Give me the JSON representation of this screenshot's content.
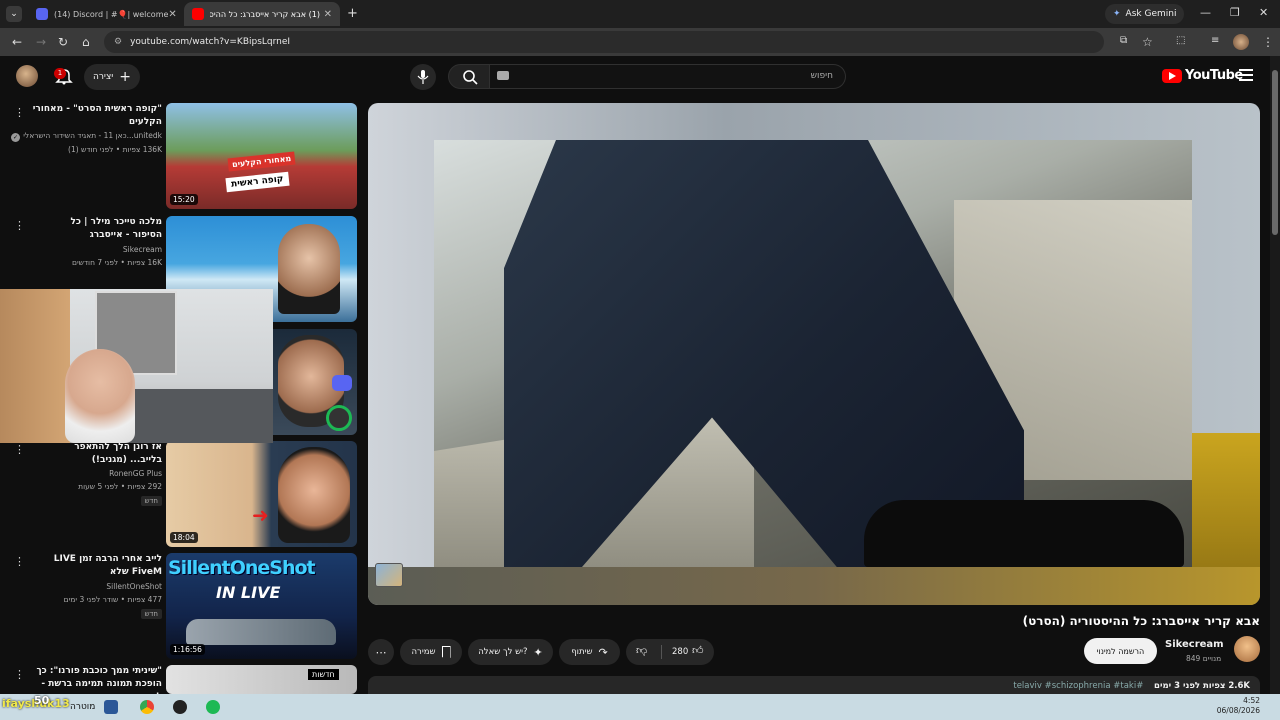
{
  "browser": {
    "tabs": [
      {
        "label": "(14) Discord | #🎈| welcome"
      },
      {
        "label": "(1) אבא קריר אייסברג: כל ההיסטוריה"
      }
    ],
    "gemini_label": "Ask Gemini",
    "url": "youtube.com/watch?v=KBipsLqrneI"
  },
  "yt": {
    "logo": "YouTube",
    "search_placeholder": "חיפוש",
    "create_label": "יצירה",
    "notif_count": "1"
  },
  "video": {
    "title": "אבא קריר אייסברג: כל ההיסטוריה (הסרט)",
    "channel": "Sikecream",
    "subscribers": "849 מנויים",
    "subscribe_label": "הרשמה למינוי",
    "likes": "280",
    "share_label": "שיתוף",
    "ask_label": "יש לך שאלה?",
    "save_label": "שמירה",
    "views_line": "2.6K צפיות  לפני 3 ימים",
    "tags": "#telaviv #schizophrenia #taki"
  },
  "recommendations": [
    {
      "title": "\"קופה ראשית הסרט\" - מאחורי הקלעים",
      "channel": "unitedk...כאן 11 - תאגיד השידור הישראלי",
      "meta": "136K צפיות • לפני חודש (1)",
      "duration": "15:20",
      "badge": ""
    },
    {
      "title": "מלכה טייכר מילר | כל הסיפור - אייסברג",
      "channel": "Sikecream",
      "meta": "16K צפיות • לפני 7 חודשים",
      "duration": "",
      "badge": ""
    },
    {
      "title": "אז רונן הלך להתאפר בלייב... (מגניב!)",
      "channel": "RonenGG Plus",
      "meta": "292 צפיות • לפני 5 שעות",
      "duration": "18:04",
      "badge": "חדש"
    },
    {
      "title": "לייב אחרי הרבה זמן LIVE FiveM שלא",
      "channel": "SillentOneShot",
      "meta": "477 צפיות • שודר לפני 3 ימים",
      "duration": "1:16:56",
      "badge": "חדש"
    },
    {
      "title": "\"שיניתי ממך כוכבת פורנו\": כך הופכת תמונה תמימה ברשת - לתיעוד מיני...",
      "channel": "",
      "meta": "",
      "duration": "",
      "badge": "חדשות"
    }
  ],
  "thumb_texts": {
    "t1_banner": "מאחורי הקלעים",
    "t1_sign": "קופה ראשית",
    "t4_title": "SillentOneShot",
    "t4_sub": "IN LIVE"
  },
  "taskbar": {
    "overlay": "ifayshuk13",
    "score": "50",
    "label": "מוטרה",
    "time": "4:52",
    "date": "06/08/2026"
  },
  "colors": {
    "accent": "#ff0000",
    "background": "#0f0f0f",
    "pill": "#272727"
  }
}
